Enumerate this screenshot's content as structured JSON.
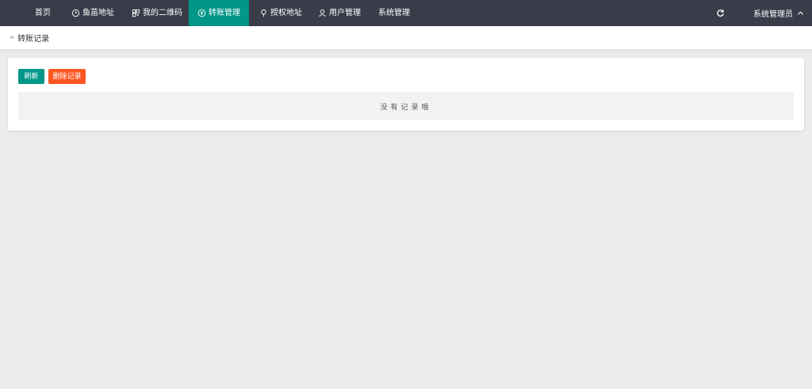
{
  "nav": {
    "items": [
      {
        "label": "首页",
        "icon": "none",
        "active": false
      },
      {
        "label": "鱼苗地址",
        "icon": "clock-icon",
        "active": false
      },
      {
        "label": "我的二维码",
        "icon": "qrcode-icon",
        "active": false
      },
      {
        "label": "转账管理",
        "icon": "yen-circle-icon",
        "active": true
      },
      {
        "label": "授权地址",
        "icon": "location-pin-icon",
        "active": false
      },
      {
        "label": "用户管理",
        "icon": "user-icon",
        "active": false
      },
      {
        "label": "系统管理",
        "icon": "none",
        "active": false
      }
    ],
    "user_label": "系统管理员"
  },
  "breadcrumb": {
    "current": "转账记录"
  },
  "toolbar": {
    "refresh_label": "刷新",
    "delete_label": "删除记录"
  },
  "table": {
    "empty_text": "没有记录哦"
  },
  "colors": {
    "topbar": "#393d49",
    "active": "#009688",
    "danger": "#ff5722",
    "background": "#ececec"
  }
}
